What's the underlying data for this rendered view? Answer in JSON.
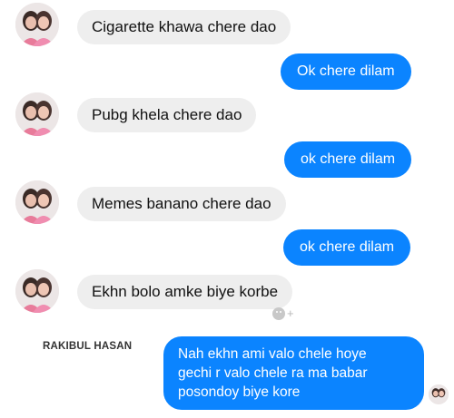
{
  "conversation": {
    "messages": [
      {
        "side": "received",
        "text": "Cigarette khawa chere dao"
      },
      {
        "side": "sent",
        "text": "Ok chere dilam"
      },
      {
        "side": "received",
        "text": "Pubg khela chere dao"
      },
      {
        "side": "sent",
        "text": "ok chere dilam"
      },
      {
        "side": "received",
        "text": "Memes banano chere dao"
      },
      {
        "side": "sent",
        "text": "ok chere dilam"
      },
      {
        "side": "received",
        "text": "Ekhn bolo amke biye korbe"
      },
      {
        "side": "sent",
        "lines": [
          "Nah ekhn ami valo chele hoye",
          "gechi r valo chele ra ma babar",
          "posondoy biye kore"
        ]
      }
    ],
    "reaction_button": {
      "icon": "add-reaction-icon",
      "label": "+"
    },
    "watermark": "RAKIBUL HASAN"
  },
  "colors": {
    "sent_bubble": "#0b84ff",
    "received_bubble": "#eeeeee"
  }
}
